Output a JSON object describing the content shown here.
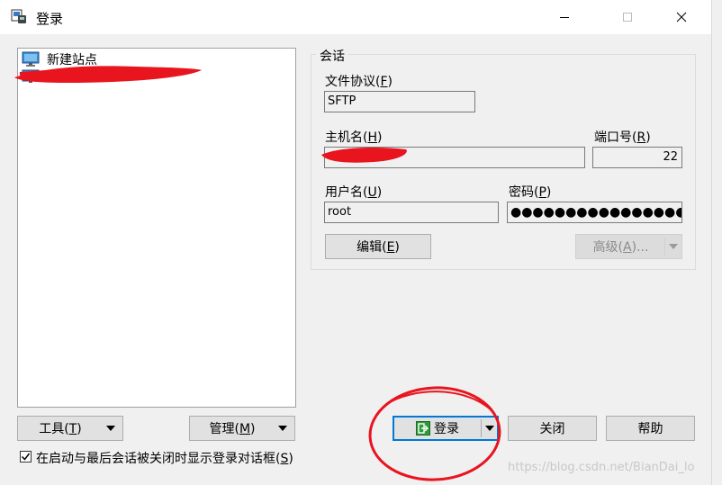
{
  "window": {
    "title": "登录",
    "icon": "winscp-app-icon",
    "controls": [
      "minimize-icon",
      "maximize-icon",
      "close-icon"
    ]
  },
  "sites": {
    "items": [
      {
        "label": "新建站点",
        "icon": "monitor-icon"
      },
      {
        "label": "",
        "icon": "monitor-icon"
      }
    ]
  },
  "session": {
    "group_label": "会话",
    "protocol_label": "文件协议(",
    "protocol_key": "F",
    "protocol_value": "SFTP",
    "host_label": "主机名(",
    "host_key": "H",
    "host_value": "",
    "port_label": "端口号(",
    "port_key": "R",
    "port_value": "22",
    "user_label": "用户名(",
    "user_key": "U",
    "user_value": "root",
    "password_label": "密码(",
    "password_key": "P",
    "password_value": "●●●●●●●●●●●●●●●●",
    "edit_button": "编辑(",
    "edit_key": "E",
    "advanced_button": "高级(",
    "advanced_key": "A",
    "advanced_suffix": ")..."
  },
  "buttons": {
    "tools": "工具(",
    "tools_key": "T",
    "manage": "管理(",
    "manage_key": "M",
    "login": "登录",
    "close": "关闭",
    "help": "帮助"
  },
  "options": {
    "show_login_dialog": "在启动与最后会话被关闭时显示登录对话框(",
    "show_login_dialog_key": "S",
    "checked": true
  },
  "paren_close": ")",
  "watermark": "https://blog.csdn.net/BianDai_lo",
  "colors": {
    "accent": "#0078d7",
    "annotation_red": "#e8141e",
    "login_icon_green": "#2e9b3b"
  }
}
